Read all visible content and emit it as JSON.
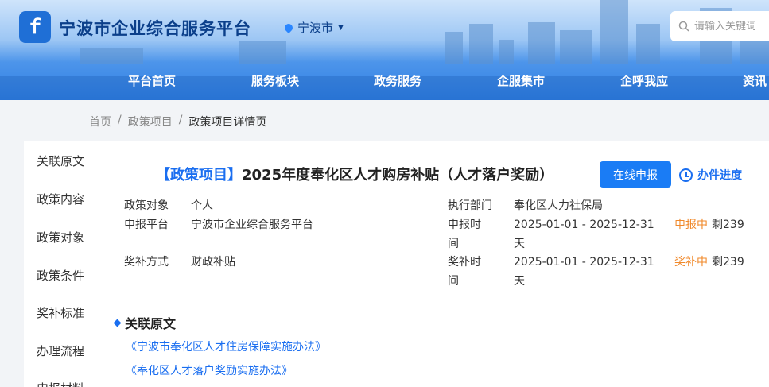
{
  "header": {
    "logo_text": "ｆ",
    "site_title": "宁波市企业综合服务平台",
    "city": "宁波市",
    "search_placeholder": "请输入关键词"
  },
  "nav": [
    "平台首页",
    "服务板块",
    "政务服务",
    "企服集市",
    "企呼我应",
    "资讯"
  ],
  "breadcrumb": {
    "home": "首页",
    "sep": "/",
    "level2": "政策项目",
    "current": "政策项目详情页"
  },
  "sidenav": [
    "关联原文",
    "政策内容",
    "政策对象",
    "政策条件",
    "奖补标准",
    "办理流程",
    "申报材料"
  ],
  "detail": {
    "tag": "【政策项目】",
    "title": "2025年度奉化区人才购房补贴（人才落户奖励）",
    "apply_button": "在线申报",
    "progress_link": "办件进度",
    "target_label": "政策对象",
    "target_value": "个人",
    "platform_label": "申报平台",
    "platform_value": "宁波市企业综合服务平台",
    "method_label": "奖补方式",
    "method_value": "财政补贴",
    "dept_label": "执行部门",
    "dept_value": "奉化区人力社保局",
    "apply_time_label_1": "申报时",
    "apply_time_label_2": "间",
    "apply_time_value": "2025-01-01 - 2025-12-31",
    "apply_time_day": "天",
    "apply_status": "申报中",
    "apply_remaining": "剩239",
    "award_time_label_1": "奖补时",
    "award_time_label_2": "间",
    "award_time_value": "2025-01-01 - 2025-12-31",
    "award_time_day": "天",
    "award_status": "奖补中",
    "award_remaining": "剩239"
  },
  "related": {
    "title": "关联原文",
    "links": [
      "《宁波市奉化区人才住房保障实施办法》",
      "《奉化区人才落户奖励实施办法》"
    ]
  },
  "colors": {
    "primary": "#1a7cf5",
    "orange": "#f0882a",
    "header_dark": "#0b3f8a"
  }
}
